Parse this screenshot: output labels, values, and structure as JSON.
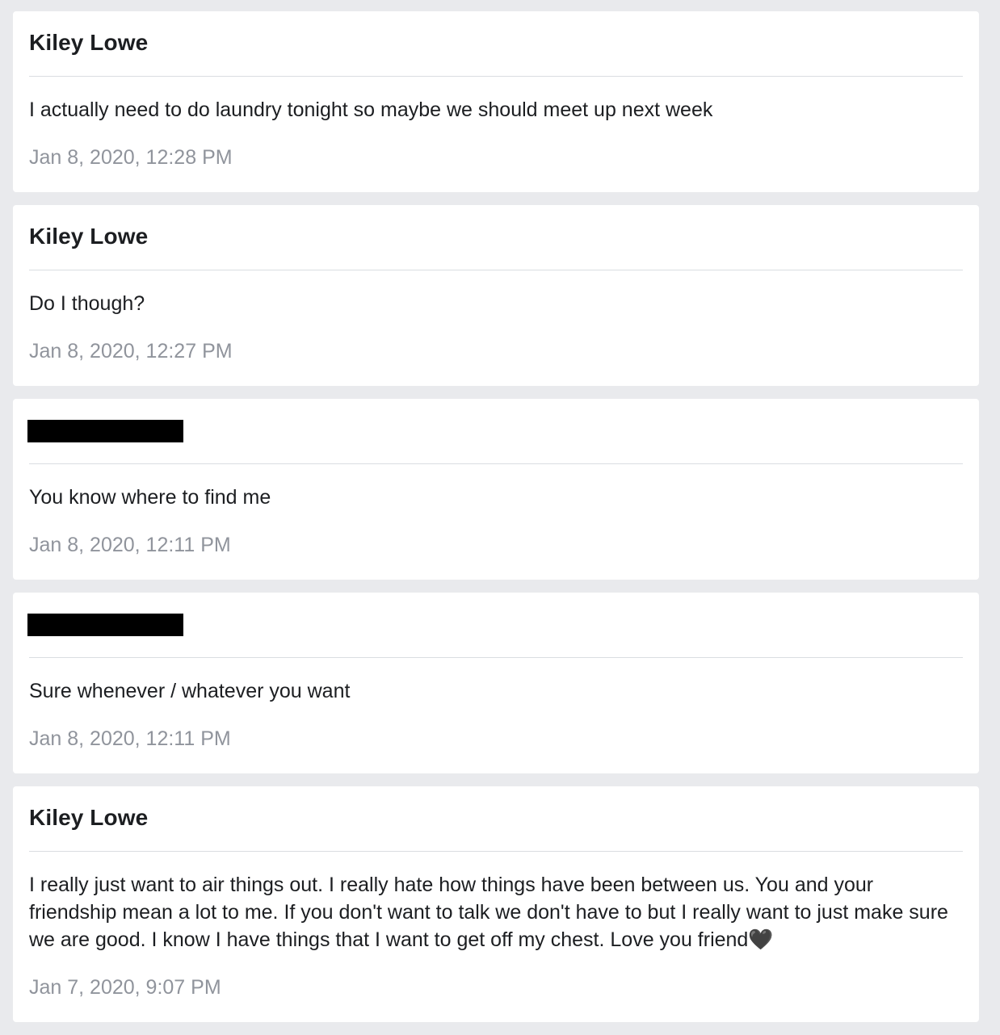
{
  "messages": [
    {
      "sender": "Kiley Lowe",
      "sender_redacted": false,
      "text": "I actually need to do laundry tonight so maybe we should meet up next week",
      "timestamp": "Jan 8, 2020, 12:28 PM"
    },
    {
      "sender": "Kiley Lowe",
      "sender_redacted": false,
      "text": "Do I though?",
      "timestamp": "Jan 8, 2020, 12:27 PM"
    },
    {
      "sender": "",
      "sender_redacted": true,
      "text": "You know where to find me",
      "timestamp": "Jan 8, 2020, 12:11 PM"
    },
    {
      "sender": "",
      "sender_redacted": true,
      "text": "Sure whenever / whatever you want",
      "timestamp": "Jan 8, 2020, 12:11 PM"
    },
    {
      "sender": "Kiley Lowe",
      "sender_redacted": false,
      "text": "I really just want to air things out. I really hate how things have been between us. You and your friendship mean a lot to me. If you don't want to talk we don't have to but I really want to just make sure we are good. I know I have things that I want to get off my chest. Love you friend🖤",
      "timestamp": "Jan 7, 2020, 9:07 PM"
    }
  ]
}
